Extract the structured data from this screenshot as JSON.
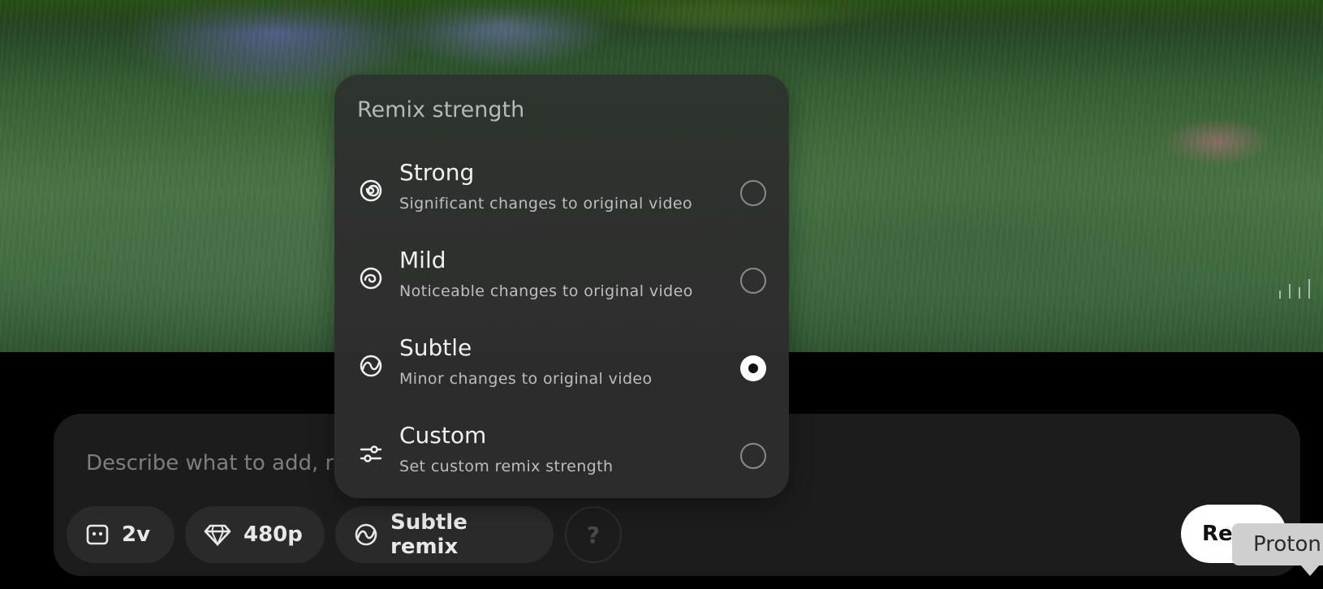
{
  "prompt": {
    "placeholder": "Describe what to add, remove, or change"
  },
  "toolbar": {
    "variants_label": "2v",
    "resolution_label": "480p",
    "remix_label": "Subtle remix",
    "help_label": "?",
    "remix_button_label": "Remix"
  },
  "tooltip": {
    "text": "Proton"
  },
  "remix_menu": {
    "title": "Remix strength",
    "items": [
      {
        "title": "Strong",
        "description": "Significant changes to original video",
        "icon": "spiral-strong-icon",
        "selected": false
      },
      {
        "title": "Mild",
        "description": "Noticeable changes to original video",
        "icon": "spiral-mild-icon",
        "selected": false
      },
      {
        "title": "Subtle",
        "description": "Minor changes to original video",
        "icon": "spiral-subtle-icon",
        "selected": true
      },
      {
        "title": "Custom",
        "description": "Set custom remix strength",
        "icon": "sliders-icon",
        "selected": false
      }
    ]
  },
  "colors": {
    "background": "#000000",
    "panel": "#1c1c1c",
    "chip": "#2a2a2a",
    "menu": "#2e2e2e",
    "accent_button": "#ffffff"
  }
}
